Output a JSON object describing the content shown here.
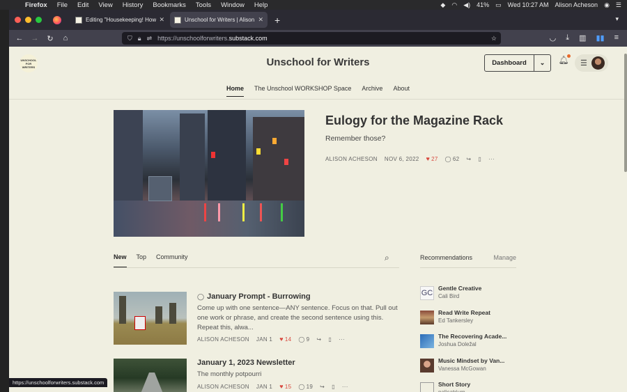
{
  "menubar": {
    "items": [
      "Firefox",
      "File",
      "Edit",
      "View",
      "History",
      "Bookmarks",
      "Tools",
      "Window",
      "Help"
    ],
    "battery": "41%",
    "clock": "Wed 10:27 AM",
    "user": "Alison Acheson"
  },
  "tabs": [
    {
      "title": "Editing \"Housekeeping! How Do"
    },
    {
      "title": "Unschool for Writers | Alison Ac"
    }
  ],
  "url": {
    "prefix": "https://unschoolforwriters.",
    "domain": "substack.com",
    "suffix": ""
  },
  "header": {
    "logo_text": "UNSCHOOL FOR WRITERS",
    "title": "Unschool for Writers",
    "dashboard": "Dashboard"
  },
  "subnav": [
    "Home",
    "The Unschool WORKSHOP Space",
    "Archive",
    "About"
  ],
  "hero": {
    "title": "Eulogy for the Magazine Rack",
    "subtitle": "Remember those?",
    "author": "ALISON ACHESON",
    "date": "NOV 6, 2022",
    "likes": "27",
    "comments": "62"
  },
  "feed_tabs": [
    "New",
    "Top",
    "Community"
  ],
  "posts": [
    {
      "title": "January Prompt - Burrowing",
      "excerpt": "Come up with one sentence—ANY sentence. Focus on that. Pull out one work or phrase, and create the second sentence using this. Repeat this, alwa...",
      "author": "ALISON ACHESON",
      "date": "JAN 1",
      "likes": "14",
      "comments": "9"
    },
    {
      "title": "January 1, 2023 Newsletter",
      "excerpt": "The monthly potpourri",
      "author": "ALISON ACHESON",
      "date": "JAN 1",
      "likes": "15",
      "comments": "19"
    }
  ],
  "recommendations": {
    "heading": "Recommendations",
    "manage": "Manage",
    "items": [
      {
        "name": "Gentle Creative",
        "author": "Cali Bird"
      },
      {
        "name": "Read Write Repeat",
        "author": "Ed Tankersley"
      },
      {
        "name": "The Recovering Acade...",
        "author": "Joshua Doležal"
      },
      {
        "name": "Music Mindset by Van...",
        "author": "Vanessa McGowan"
      },
      {
        "name": "Short Story",
        "author": "palisatrium"
      }
    ]
  },
  "status_url": "https://unschoolforwriters.substack.com",
  "colors": {
    "page_bg": "#f0efe1",
    "heart": "#d8493f",
    "notification": "#e8692a"
  }
}
